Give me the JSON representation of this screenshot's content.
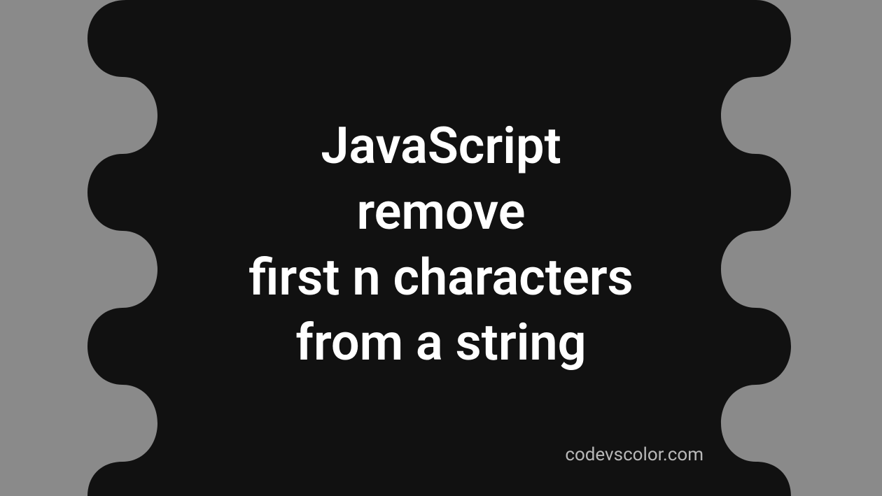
{
  "title_lines": "JavaScript\nremove\nfirst n characters\nfrom a string",
  "watermark": "codevscolor.com",
  "colors": {
    "bg": "#8a8a8a",
    "blob": "#111111",
    "text": "#ffffff",
    "watermark": "#b8b8b8"
  }
}
